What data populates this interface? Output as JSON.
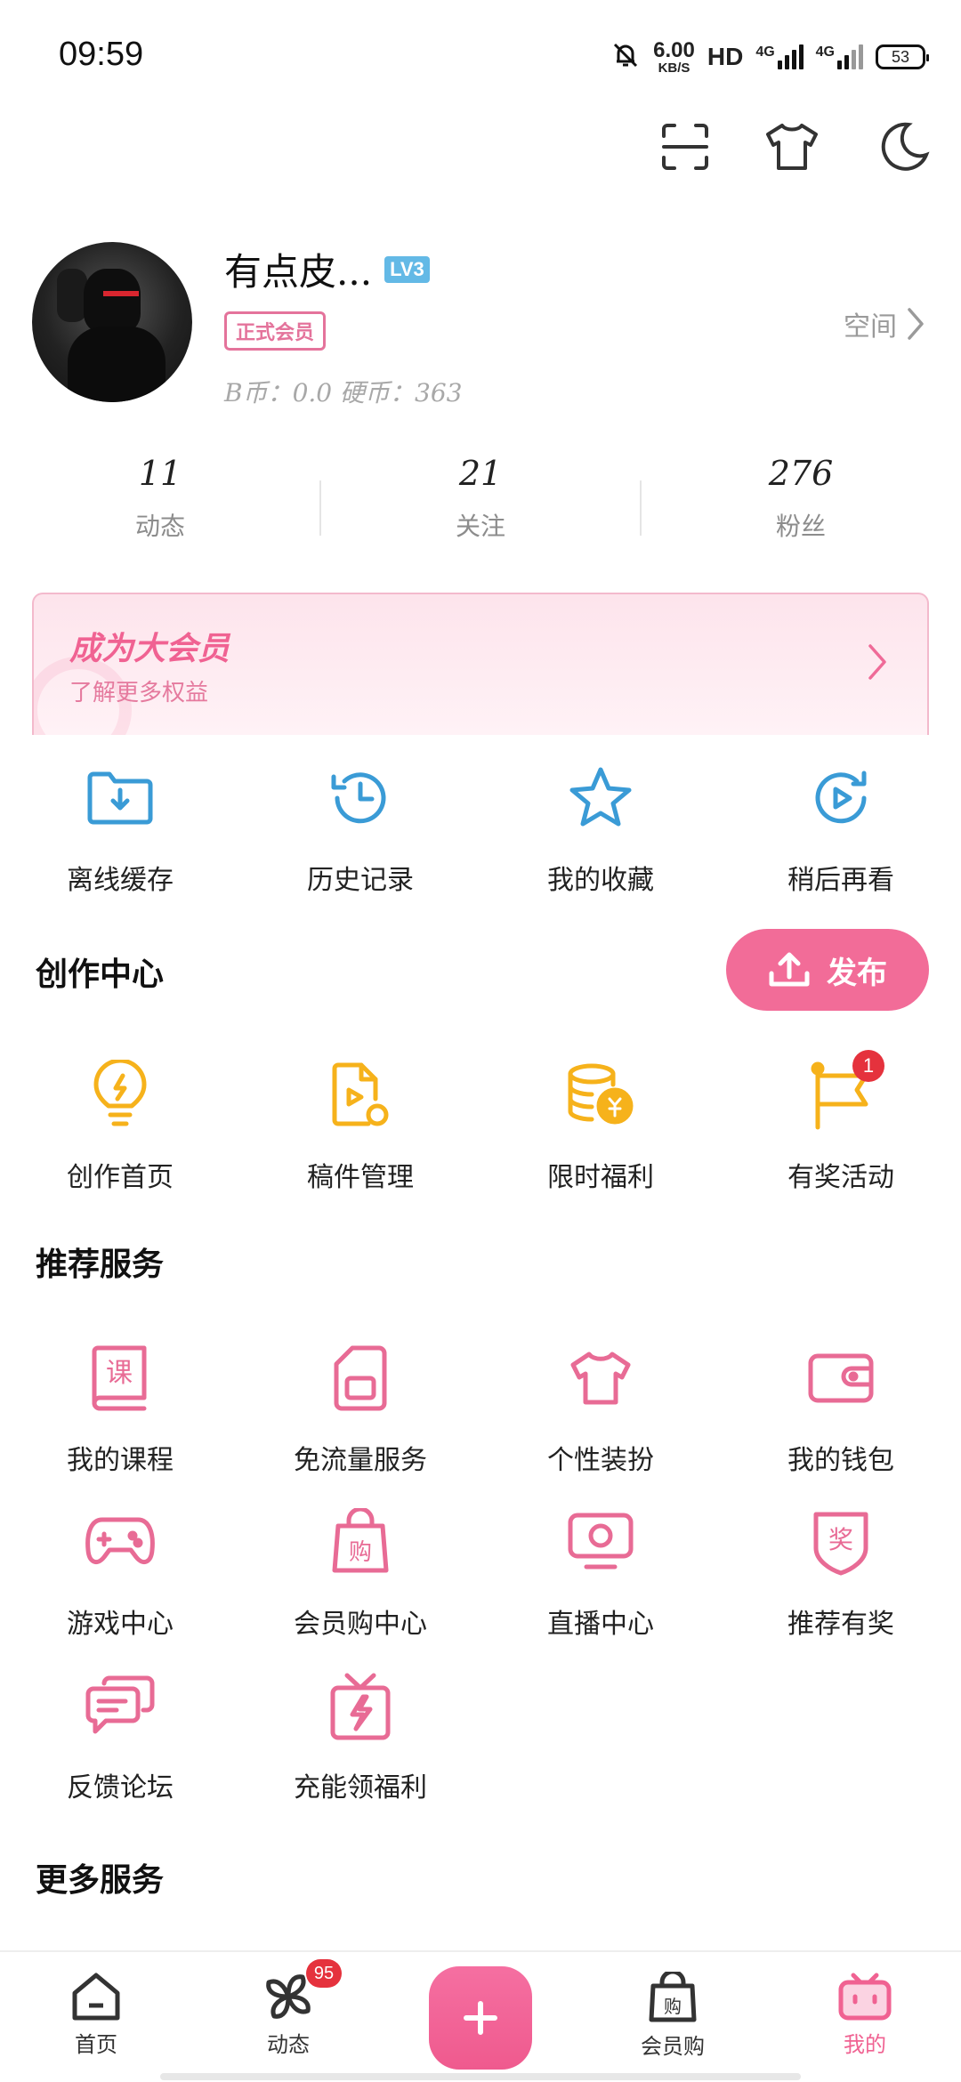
{
  "status": {
    "time": "09:59",
    "speed_value": "6.00",
    "speed_unit": "KB/S",
    "hd_label": "HD",
    "net1": "4G",
    "net2": "4G",
    "battery": "53"
  },
  "profile": {
    "name": "有点皮...",
    "level": "LV3",
    "vip_tag": "正式会员",
    "coins": "B币：0.0   硬币：363",
    "space_label": "空间"
  },
  "stats": [
    {
      "value": "11",
      "label": "动态"
    },
    {
      "value": "21",
      "label": "关注"
    },
    {
      "value": "276",
      "label": "粉丝"
    }
  ],
  "vip_banner": {
    "title": "成为大会员",
    "subtitle": "了解更多权益"
  },
  "quick": [
    {
      "label": "离线缓存",
      "icon": "download-folder-icon"
    },
    {
      "label": "历史记录",
      "icon": "history-clock-icon"
    },
    {
      "label": "我的收藏",
      "icon": "star-icon"
    },
    {
      "label": "稍后再看",
      "icon": "play-later-icon"
    }
  ],
  "creation": {
    "title": "创作中心",
    "publish_label": "发布",
    "items": [
      {
        "label": "创作首页",
        "icon": "lightbulb-icon"
      },
      {
        "label": "稿件管理",
        "icon": "manuscript-icon"
      },
      {
        "label": "限时福利",
        "icon": "coins-icon"
      },
      {
        "label": "有奖活动",
        "icon": "flag-icon",
        "badge": "1"
      }
    ]
  },
  "services": {
    "title": "推荐服务",
    "items": [
      {
        "label": "我的课程",
        "icon": "course-book-icon",
        "glyph": "课"
      },
      {
        "label": "免流量服务",
        "icon": "sim-card-icon"
      },
      {
        "label": "个性装扮",
        "icon": "tshirt-icon"
      },
      {
        "label": "我的钱包",
        "icon": "wallet-icon"
      },
      {
        "label": "游戏中心",
        "icon": "gamepad-icon"
      },
      {
        "label": "会员购中心",
        "icon": "shopping-bag-icon",
        "glyph": "购"
      },
      {
        "label": "直播中心",
        "icon": "tv-icon"
      },
      {
        "label": "推荐有奖",
        "icon": "award-shield-icon",
        "glyph": "奖"
      },
      {
        "label": "反馈论坛",
        "icon": "chat-bubbles-icon"
      },
      {
        "label": "充能领福利",
        "icon": "gift-bolt-icon"
      }
    ]
  },
  "more": {
    "title": "更多服务"
  },
  "tabs": [
    {
      "label": "首页",
      "icon": "home-icon"
    },
    {
      "label": "动态",
      "icon": "pinwheel-icon",
      "badge": "95"
    },
    {
      "label": "",
      "icon": "plus-icon"
    },
    {
      "label": "会员购",
      "icon": "shopping-bag-icon",
      "glyph": "购"
    },
    {
      "label": "我的",
      "icon": "tv-mascot-icon"
    }
  ],
  "colors": {
    "accent_pink": "#f26c98",
    "icon_blue": "#3a9bd6",
    "icon_yellow": "#f6b21b",
    "icon_pink": "#e86b95",
    "badge_red": "#e5323d"
  }
}
